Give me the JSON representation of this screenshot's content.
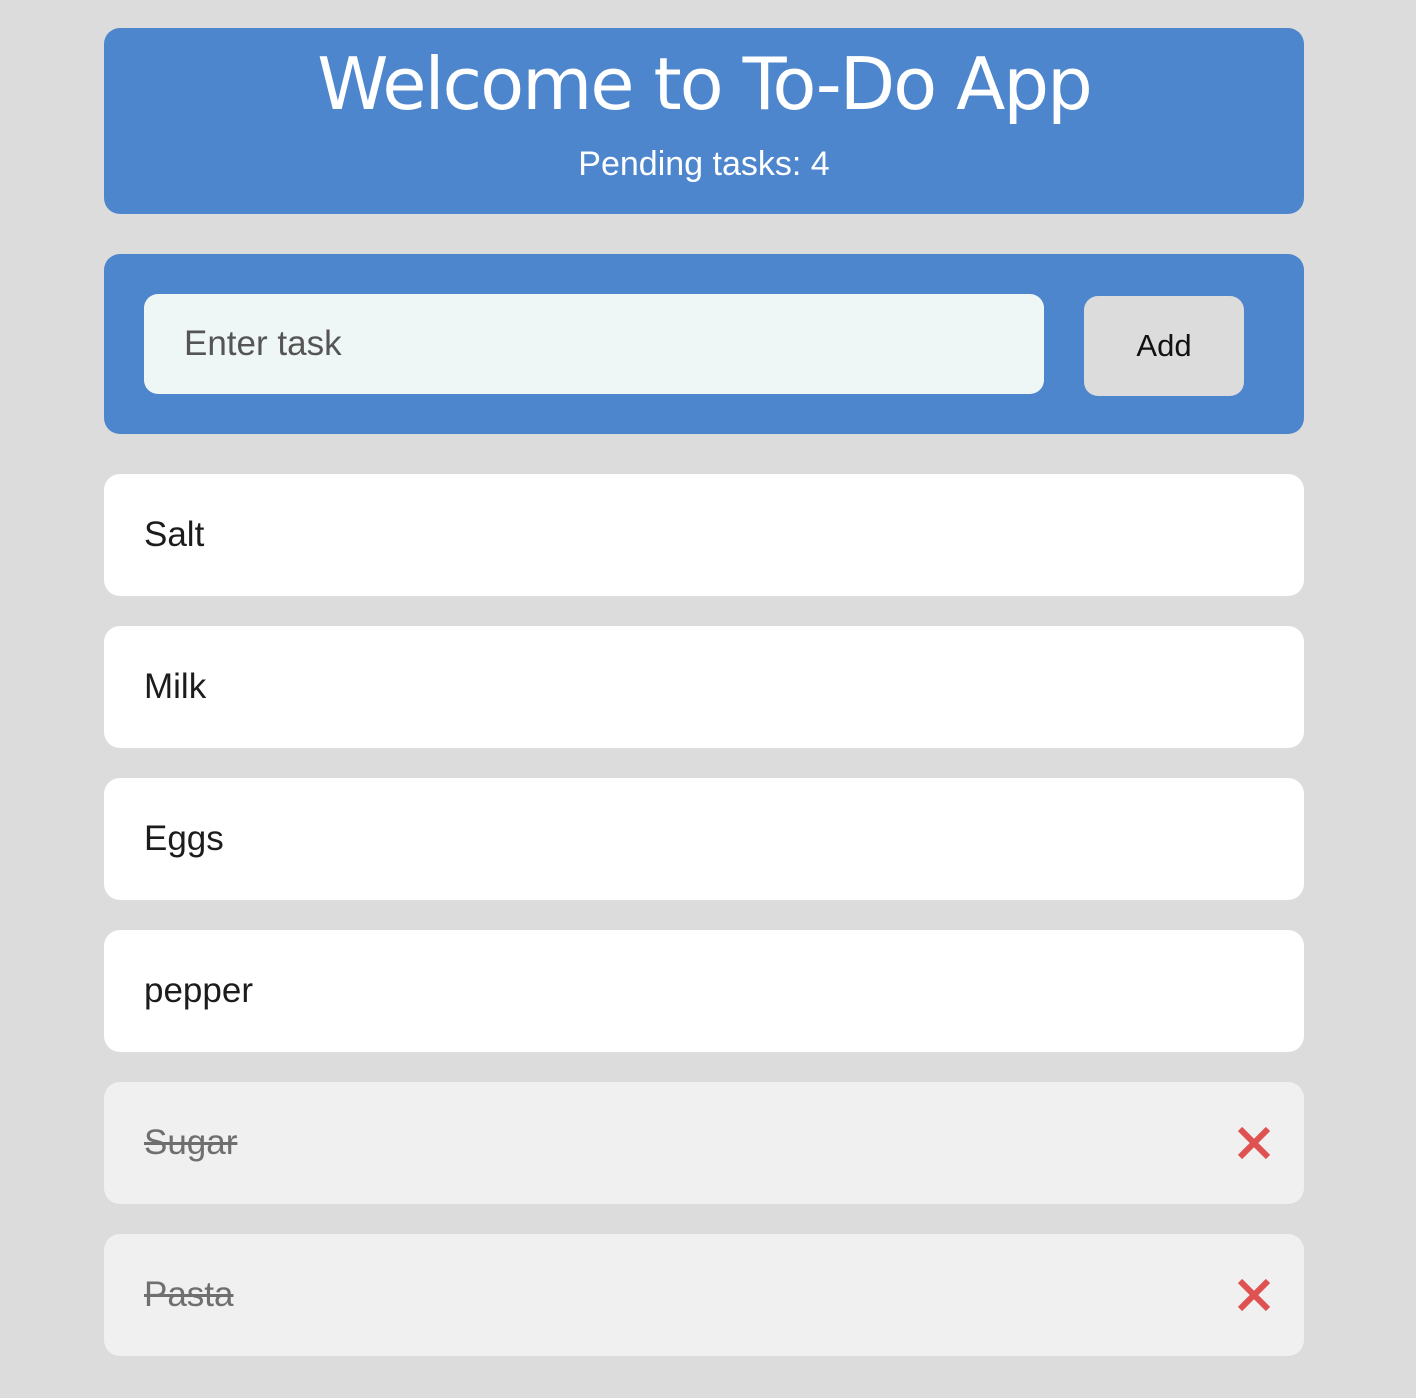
{
  "header": {
    "title": "Welcome to To-Do App",
    "pending_label": "Pending tasks: 4"
  },
  "form": {
    "input_placeholder": "Enter task",
    "input_value": "",
    "add_label": "Add"
  },
  "tasks": [
    {
      "label": "Salt",
      "completed": false
    },
    {
      "label": "Milk",
      "completed": false
    },
    {
      "label": "Eggs",
      "completed": false
    },
    {
      "label": "pepper",
      "completed": false
    },
    {
      "label": "Sugar",
      "completed": true,
      "delete_icon": "close-icon"
    },
    {
      "label": "Pasta",
      "completed": true,
      "delete_icon": "close-icon"
    }
  ],
  "colors": {
    "page_bg": "#dcdcdc",
    "panel_blue": "#4d86cd",
    "input_bg": "#eff6f6",
    "delete_red": "#e05252",
    "done_bg": "#f0f0f0"
  }
}
